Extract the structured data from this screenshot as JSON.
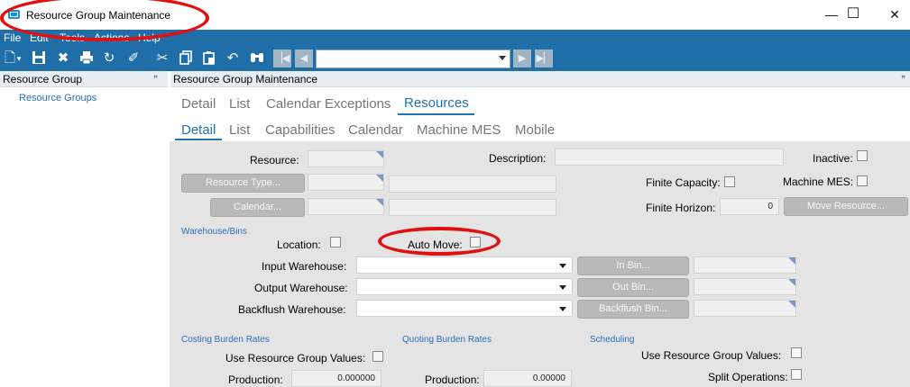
{
  "window": {
    "title": "Resource Group Maintenance",
    "controls": [
      "—",
      "☐",
      "✕"
    ]
  },
  "menu": [
    "File",
    "Edit",
    "Tools",
    "Actions",
    "Help"
  ],
  "toolbar": {
    "icons": [
      "new-icon",
      "save-icon",
      "delete-icon",
      "print-icon",
      "refresh-icon",
      "clear-icon",
      "cut-icon",
      "copy-icon",
      "paste-icon",
      "undo-icon",
      "search-icon"
    ],
    "nav_value": ""
  },
  "tree": {
    "title": "Resource Group",
    "pin": "ꟸ",
    "node": "Resource Groups"
  },
  "main": {
    "title": "Resource Group Maintenance",
    "pin": "ꟸ",
    "tabs": [
      "Detail",
      "List",
      "Calendar Exceptions",
      "Resources"
    ],
    "active_tab": "Resources",
    "subtabs": [
      "Detail",
      "List",
      "Capabilities",
      "Calendar",
      "Machine MES",
      "Mobile"
    ],
    "active_subtab": "Detail"
  },
  "form": {
    "resource_label": "Resource:",
    "description_label": "Description:",
    "inactive_label": "Inactive:",
    "resource_type_button": "Resource Type...",
    "calendar_button": "Calendar...",
    "finite_capacity_label": "Finite Capacity:",
    "machine_mes_label": "Machine MES:",
    "finite_horizon_label": "Finite Horizon:",
    "finite_horizon_value": "0",
    "move_resource_button": "Move Resource...",
    "warehouse_section": "Warehouse/Bins",
    "location_label": "Location:",
    "auto_move_label": "Auto Move:",
    "input_warehouse_label": "Input Warehouse:",
    "output_warehouse_label": "Output Warehouse:",
    "backflush_warehouse_label": "Backflush Warehouse:",
    "in_bin_button": "In Bin...",
    "out_bin_button": "Out Bin...",
    "backflush_bin_button": "Backflush Bin...",
    "costing_section": "Costing Burden Rates",
    "quoting_section": "Quoting Burden Rates",
    "scheduling_section": "Scheduling",
    "use_rg_values_label": "Use Resource Group Values:",
    "production_label": "Production:",
    "costing_production_value": "0.000000",
    "quoting_production_value": "0.00000",
    "sched_use_rg_values_label": "Use Resource Group Values:",
    "split_operations_label": "Split Operations:"
  },
  "annotation_color": "#e01010"
}
